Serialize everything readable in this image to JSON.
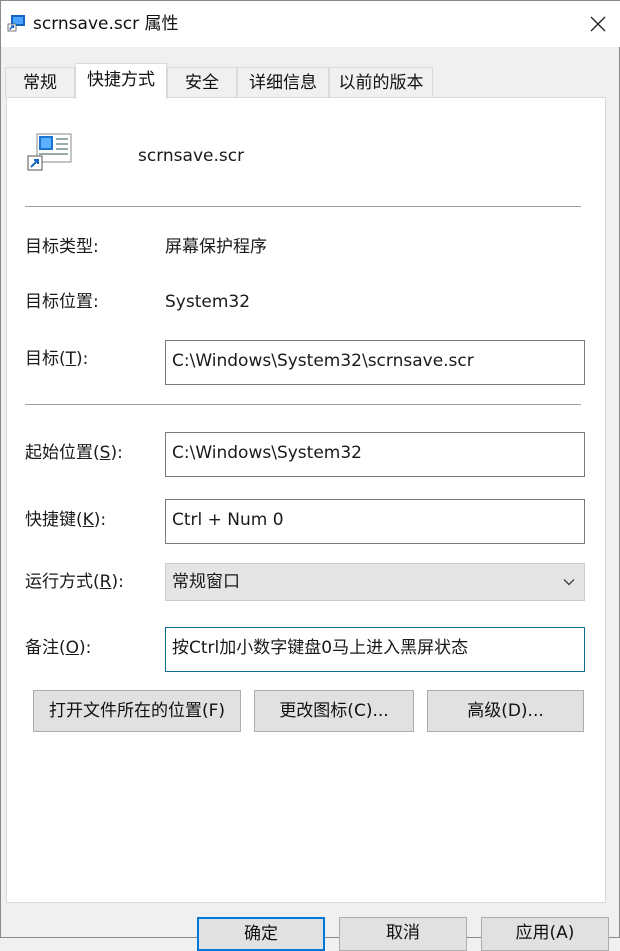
{
  "window": {
    "title": "scrnsave.scr 属性",
    "close_glyph": "✕",
    "icon": "shortcut-app-icon"
  },
  "tabs": [
    {
      "label": "常规",
      "active": false
    },
    {
      "label": "快捷方式",
      "active": true
    },
    {
      "label": "安全",
      "active": false
    },
    {
      "label": "详细信息",
      "active": false
    },
    {
      "label": "以前的版本",
      "active": false
    }
  ],
  "shortcut": {
    "file_name": "scrnsave.scr",
    "target_type_label": "目标类型:",
    "target_type_value": "屏幕保护程序",
    "target_location_label": "目标位置:",
    "target_location_value": "System32",
    "target_label_pre": "目标(",
    "target_label_key": "T",
    "target_label_post": "):",
    "target_value": "C:\\Windows\\System32\\scrnsave.scr",
    "start_in_label_pre": "起始位置(",
    "start_in_label_key": "S",
    "start_in_label_post": "):",
    "start_in_value": "C:\\Windows\\System32",
    "hotkey_label_pre": "快捷键(",
    "hotkey_label_key": "K",
    "hotkey_label_post": "):",
    "hotkey_value": "Ctrl + Num 0",
    "run_label_pre": "运行方式(",
    "run_label_key": "R",
    "run_label_post": "):",
    "run_value": "常规窗口",
    "comment_label_pre": "备注(",
    "comment_label_key": "O",
    "comment_label_post": "):",
    "comment_value": "按Ctrl加小数字键盘0马上进入黑屏状态"
  },
  "buttons": {
    "open_location": "打开文件所在的位置(F)",
    "change_icon": "更改图标(C)...",
    "advanced": "高级(D)..."
  },
  "footer": {
    "ok": "确定",
    "cancel": "取消",
    "apply": "应用(A)"
  },
  "colors": {
    "accent": "#0078d7",
    "focus_border": "#0a6e8c"
  }
}
